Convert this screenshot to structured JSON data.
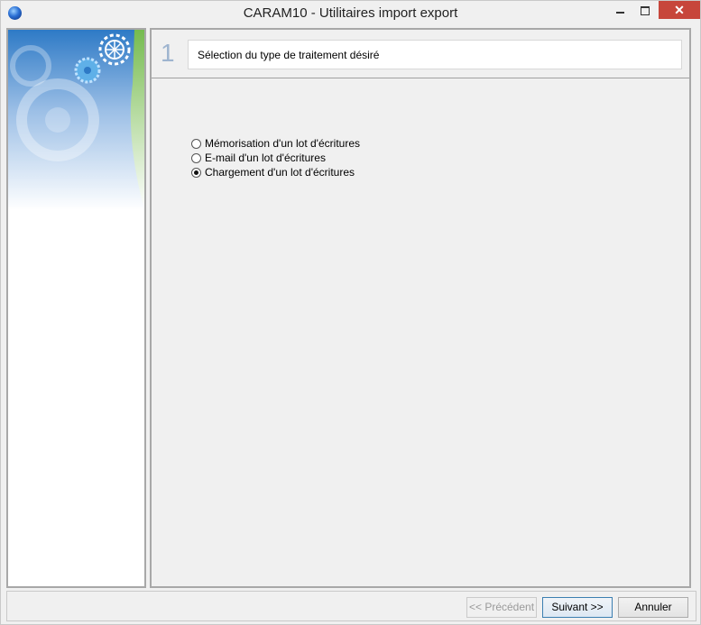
{
  "window": {
    "title": "CARAM10 - Utilitaires import export",
    "controls": {
      "minimize": "minimize-icon",
      "maximize": "maximize-icon",
      "close": "✕"
    }
  },
  "step": {
    "number": "1",
    "title": "Sélection du type de traitement désiré"
  },
  "options": [
    {
      "label": "Mémorisation d'un lot d'écritures",
      "selected": false
    },
    {
      "label": "E-mail d'un lot d'écritures",
      "selected": false
    },
    {
      "label": "Chargement d'un lot d'écritures",
      "selected": true
    }
  ],
  "buttons": {
    "previous": "<< Précédent",
    "next": "Suivant >>",
    "cancel": "Annuler"
  },
  "colors": {
    "accent_green": "#7dc242",
    "banner_blue": "#2f78c6",
    "close_red": "#c7463b"
  }
}
